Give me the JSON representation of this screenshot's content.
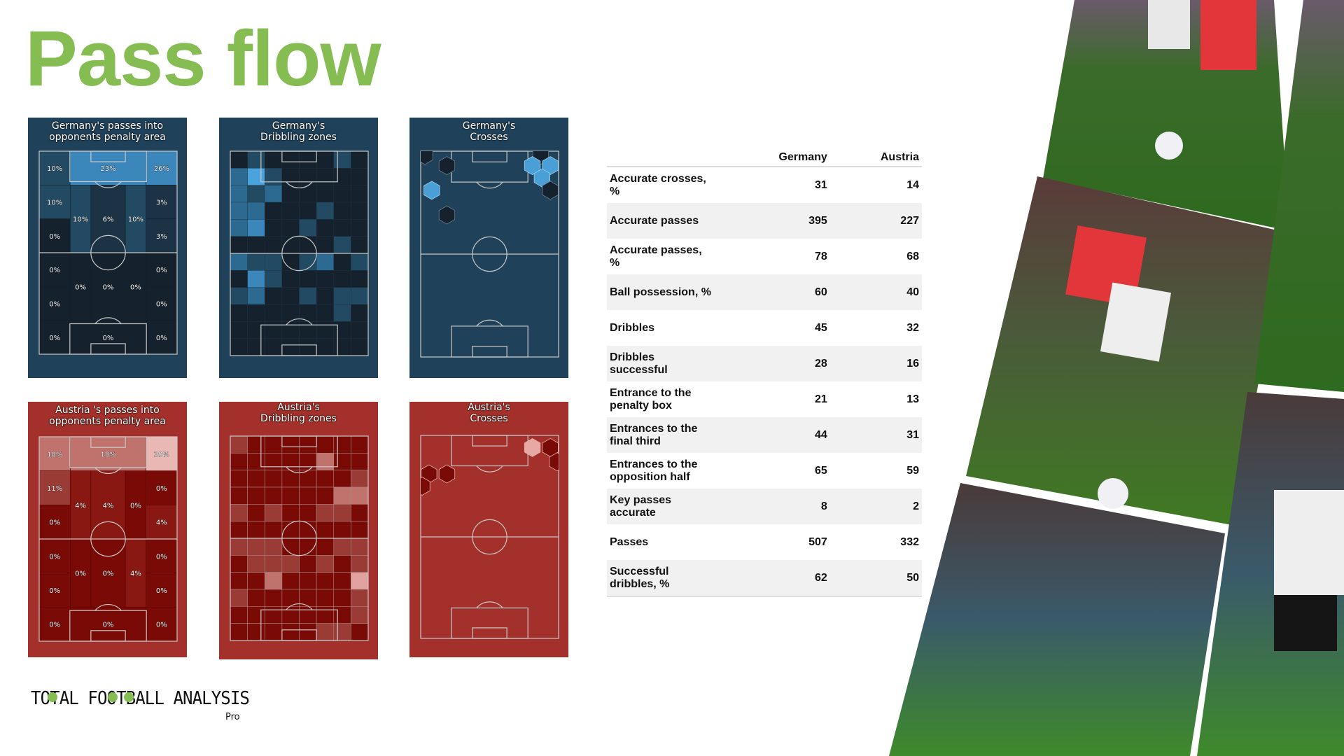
{
  "page": {
    "title": "Pass flow",
    "colors": {
      "title_green": "#86BD53",
      "germany_bg": "#1f4159",
      "austria_bg": "#a3302a"
    }
  },
  "panels": {
    "germany_passes": {
      "title_line1": "Germany's passes into",
      "title_line2": "opponents penalty area"
    },
    "germany_dribbling": {
      "title_line1": "Germany's",
      "title_line2": "Dribbling zones"
    },
    "germany_crosses": {
      "title_line1": "Germany's",
      "title_line2": "Crosses"
    },
    "austria_passes": {
      "title_line1": "Austria 's passes into",
      "title_line2": "opponents penalty area"
    },
    "austria_dribbling": {
      "title_line1": "Austria's",
      "title_line2": "Dribbling zones"
    },
    "austria_crosses": {
      "title_line1": "Austria's",
      "title_line2": "Crosses"
    }
  },
  "chart_data": [
    {
      "type": "heatmap",
      "id": "germany_passes",
      "title": "Germany's passes into opponents penalty area",
      "orientation": "attacking-up",
      "zones": [
        {
          "zone": "top-left",
          "value": "10%"
        },
        {
          "zone": "top-center-box",
          "value": "23%"
        },
        {
          "zone": "top-right",
          "value": "26%"
        },
        {
          "zone": "upper-left-wing",
          "value": "10%"
        },
        {
          "zone": "upper-right-wing",
          "value": "3%"
        },
        {
          "zone": "upper-left-halfspace",
          "value": "10%"
        },
        {
          "zone": "upper-center",
          "value": "6%"
        },
        {
          "zone": "upper-right-halfspace",
          "value": "10%"
        },
        {
          "zone": "mid-left-wing",
          "value": "0%"
        },
        {
          "zone": "mid-right-wing",
          "value": "3%"
        },
        {
          "zone": "lower-left-wing-1",
          "value": "0%"
        },
        {
          "zone": "lower-right-wing-1",
          "value": "0%"
        },
        {
          "zone": "lower-left-halfspace",
          "value": "0%"
        },
        {
          "zone": "lower-center",
          "value": "0%"
        },
        {
          "zone": "lower-right-halfspace",
          "value": "0%"
        },
        {
          "zone": "lower-left-wing-2",
          "value": "0%"
        },
        {
          "zone": "lower-right-wing-2",
          "value": "0%"
        },
        {
          "zone": "bottom-left",
          "value": "0%"
        },
        {
          "zone": "bottom-center-box",
          "value": "0%"
        },
        {
          "zone": "bottom-right",
          "value": "0%"
        }
      ]
    },
    {
      "type": "heatmap",
      "id": "austria_passes",
      "title": "Austria 's passes into opponents penalty area",
      "orientation": "attacking-up",
      "zones": [
        {
          "zone": "top-left",
          "value": "18%"
        },
        {
          "zone": "top-center-box",
          "value": "18%"
        },
        {
          "zone": "top-right",
          "value": "39%"
        },
        {
          "zone": "upper-left-wing",
          "value": "11%"
        },
        {
          "zone": "upper-right-wing",
          "value": "0%"
        },
        {
          "zone": "upper-left-halfspace",
          "value": "4%"
        },
        {
          "zone": "upper-center",
          "value": "4%"
        },
        {
          "zone": "upper-right-halfspace",
          "value": "0%"
        },
        {
          "zone": "mid-left-wing",
          "value": "0%"
        },
        {
          "zone": "mid-right-wing",
          "value": "4%"
        },
        {
          "zone": "lower-left-wing-1",
          "value": "0%"
        },
        {
          "zone": "lower-right-wing-1",
          "value": "0%"
        },
        {
          "zone": "lower-left-halfspace",
          "value": "0%"
        },
        {
          "zone": "lower-center",
          "value": "0%"
        },
        {
          "zone": "lower-right-halfspace",
          "value": "4%"
        },
        {
          "zone": "lower-left-wing-2",
          "value": "0%"
        },
        {
          "zone": "lower-right-wing-2",
          "value": "0%"
        },
        {
          "zone": "bottom-left",
          "value": "0%"
        },
        {
          "zone": "bottom-center-box",
          "value": "0%"
        },
        {
          "zone": "bottom-right",
          "value": "0%"
        }
      ]
    },
    {
      "type": "heatmap",
      "id": "germany_dribbling",
      "title": "Germany's Dribbling zones",
      "grid": "8x12",
      "intensity_scale": "0-4",
      "rows": [
        [
          0,
          1,
          0,
          0,
          0,
          0,
          1,
          0
        ],
        [
          2,
          4,
          1,
          0,
          0,
          0,
          0,
          0
        ],
        [
          2,
          1,
          2,
          0,
          0,
          0,
          0,
          0
        ],
        [
          2,
          2,
          0,
          0,
          0,
          1,
          0,
          0
        ],
        [
          2,
          3,
          0,
          0,
          1,
          0,
          0,
          0
        ],
        [
          0,
          0,
          0,
          0,
          0,
          0,
          1,
          0
        ],
        [
          2,
          1,
          1,
          0,
          1,
          2,
          0,
          1
        ],
        [
          0,
          3,
          1,
          0,
          0,
          0,
          0,
          0
        ],
        [
          1,
          2,
          0,
          0,
          1,
          0,
          1,
          1
        ],
        [
          0,
          0,
          0,
          0,
          0,
          0,
          1,
          0
        ],
        [
          0,
          0,
          0,
          0,
          0,
          0,
          0,
          0
        ],
        [
          0,
          0,
          0,
          0,
          0,
          0,
          0,
          0
        ]
      ]
    },
    {
      "type": "heatmap",
      "id": "austria_dribbling",
      "title": "Austria's Dribbling zones",
      "grid": "8x12",
      "intensity_scale": "0-3",
      "rows": [
        [
          1,
          0,
          0,
          0,
          0,
          0,
          0,
          0
        ],
        [
          0,
          0,
          0,
          0,
          0,
          2,
          0,
          0
        ],
        [
          0,
          0,
          0,
          0,
          0,
          0,
          0,
          1
        ],
        [
          0,
          0,
          0,
          0,
          0,
          0,
          2,
          2
        ],
        [
          1,
          0,
          1,
          0,
          0,
          1,
          1,
          0
        ],
        [
          0,
          0,
          0,
          0,
          0,
          0,
          0,
          0
        ],
        [
          1,
          1,
          1,
          0,
          0,
          0,
          1,
          1
        ],
        [
          0,
          1,
          1,
          1,
          0,
          1,
          0,
          1
        ],
        [
          0,
          0,
          2,
          0,
          0,
          0,
          0,
          3
        ],
        [
          1,
          0,
          0,
          0,
          0,
          0,
          0,
          1
        ],
        [
          0,
          0,
          0,
          0,
          0,
          0,
          0,
          1
        ],
        [
          0,
          0,
          0,
          0,
          0,
          1,
          1,
          0
        ]
      ]
    },
    {
      "type": "heatmap",
      "id": "germany_crosses",
      "title": "Germany's Crosses",
      "style": "hexbin",
      "bins": [
        {
          "x": 0.03,
          "y": 0.02,
          "level": "low"
        },
        {
          "x": 0.19,
          "y": 0.07,
          "level": "low"
        },
        {
          "x": 0.08,
          "y": 0.19,
          "level": "high"
        },
        {
          "x": 0.19,
          "y": 0.31,
          "level": "low"
        },
        {
          "x": 0.87,
          "y": 0.02,
          "level": "low"
        },
        {
          "x": 0.81,
          "y": 0.07,
          "level": "high"
        },
        {
          "x": 0.94,
          "y": 0.07,
          "level": "high"
        },
        {
          "x": 0.88,
          "y": 0.13,
          "level": "high"
        },
        {
          "x": 0.94,
          "y": 0.19,
          "level": "low"
        }
      ]
    },
    {
      "type": "heatmap",
      "id": "austria_crosses",
      "title": "Austria's Crosses",
      "style": "hexbin",
      "bins": [
        {
          "x": 0.06,
          "y": 0.19,
          "level": "low"
        },
        {
          "x": 0.19,
          "y": 0.19,
          "level": "low"
        },
        {
          "x": 0.01,
          "y": 0.25,
          "level": "low"
        },
        {
          "x": 0.81,
          "y": 0.06,
          "level": "high"
        },
        {
          "x": 0.94,
          "y": 0.06,
          "level": "low"
        },
        {
          "x": 0.99,
          "y": 0.13,
          "level": "low"
        }
      ]
    }
  ],
  "stats_table": {
    "columns": [
      "",
      "Germany",
      "Austria"
    ],
    "rows": [
      {
        "label": "Accurate crosses, %",
        "germany": "31",
        "austria": "14"
      },
      {
        "label": "Accurate passes",
        "germany": "395",
        "austria": "227"
      },
      {
        "label": "Accurate passes, %",
        "germany": "78",
        "austria": "68"
      },
      {
        "label": "Ball possession, %",
        "germany": "60",
        "austria": "40"
      },
      {
        "label": "Dribbles",
        "germany": "45",
        "austria": "32"
      },
      {
        "label": "Dribbles successful",
        "germany": "28",
        "austria": "16"
      },
      {
        "label": "Entrance to the penalty box",
        "germany": "21",
        "austria": "13"
      },
      {
        "label": "Entrances to the final third",
        "germany": "44",
        "austria": "31"
      },
      {
        "label": "Entrances to the opposition half",
        "germany": "65",
        "austria": "59"
      },
      {
        "label": "Key passes accurate",
        "germany": "8",
        "austria": "2"
      },
      {
        "label": "Passes",
        "germany": "507",
        "austria": "332"
      },
      {
        "label": "Successful dribbles, %",
        "germany": "62",
        "austria": "50"
      }
    ]
  },
  "logo": {
    "line1": "TOTAL FOOTBALL ANALYSIS",
    "sub": "Pro"
  }
}
